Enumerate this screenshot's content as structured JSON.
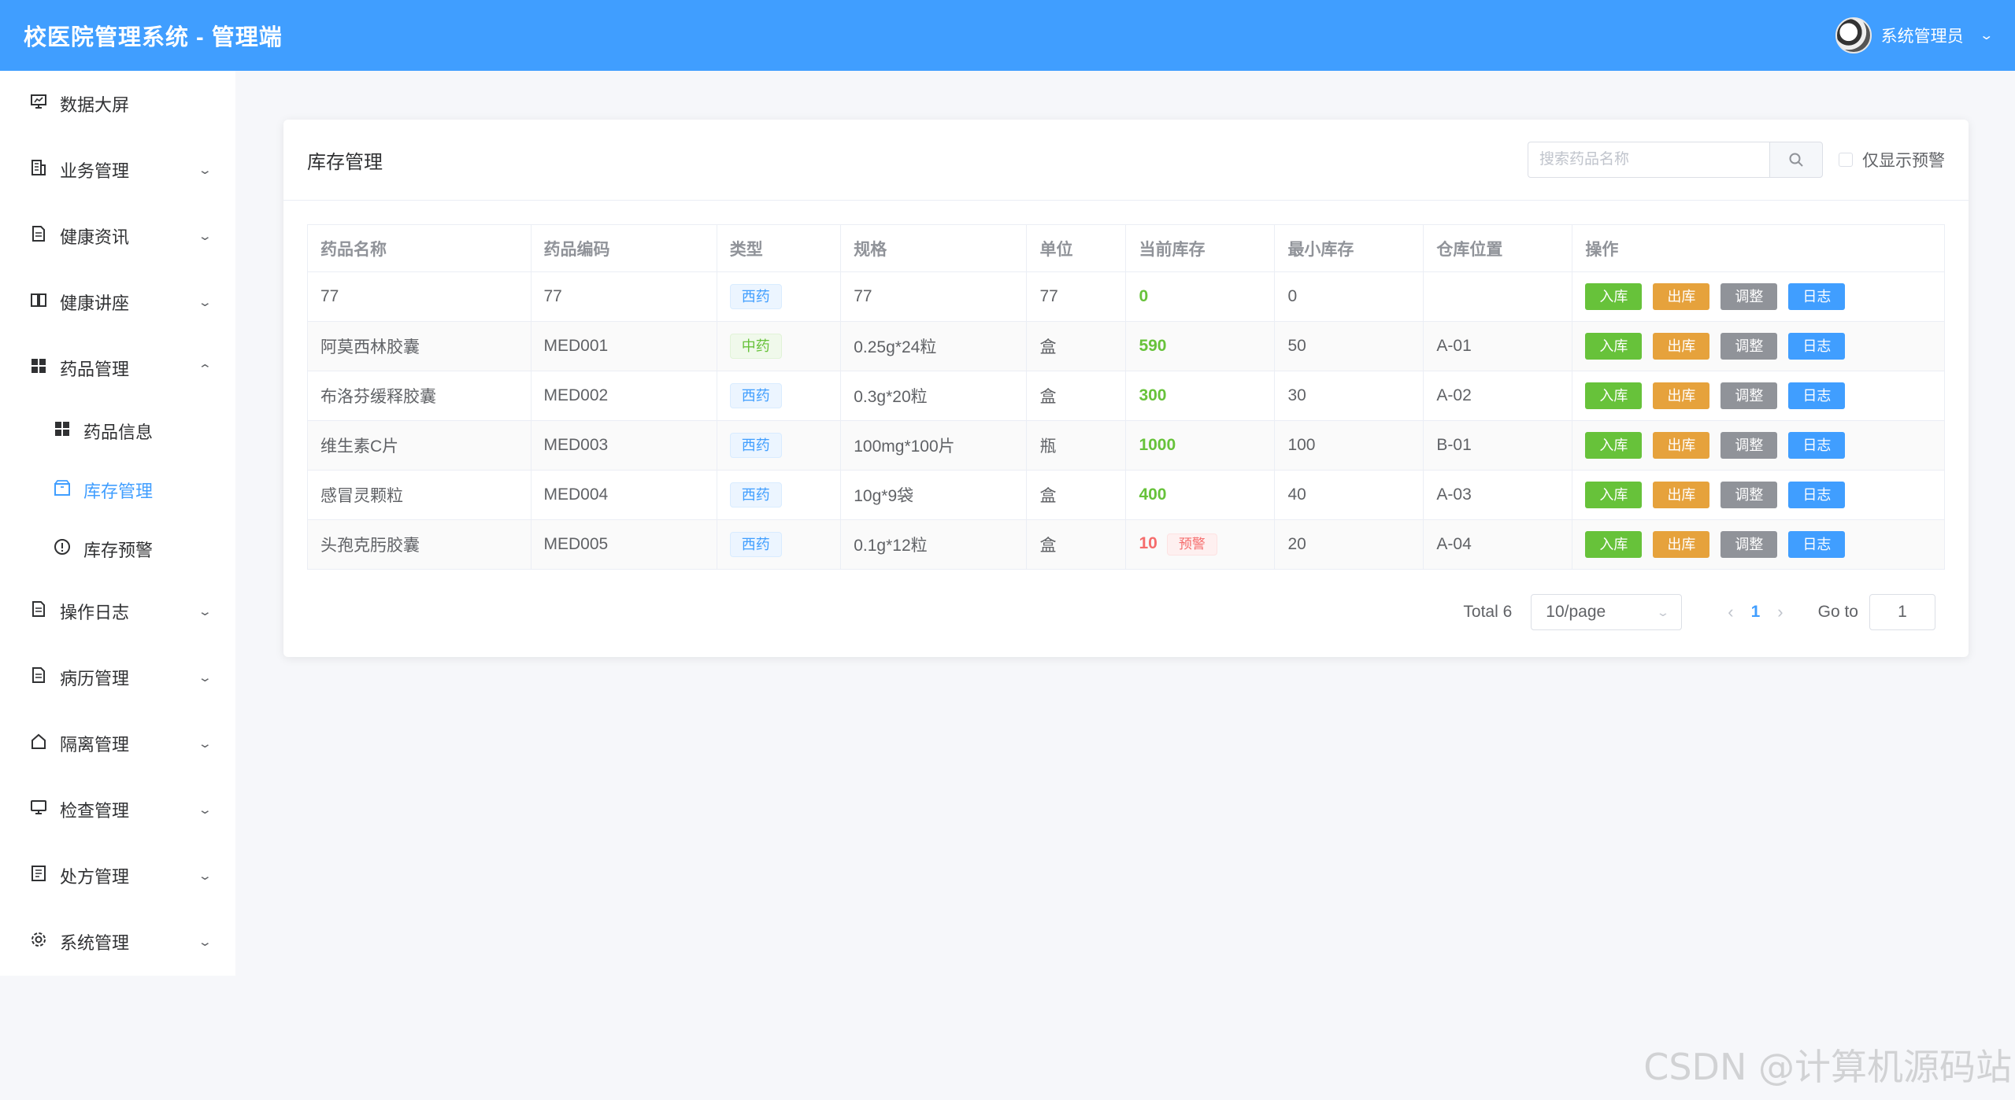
{
  "header": {
    "title": "校医院管理系统 - 管理端",
    "username": "系统管理员"
  },
  "sidebar": {
    "items": [
      {
        "label": "数据大屏",
        "icon": "monitor-chart-icon",
        "expandable": false
      },
      {
        "label": "业务管理",
        "icon": "building-icon",
        "expandable": true
      },
      {
        "label": "健康资讯",
        "icon": "document-icon",
        "expandable": true
      },
      {
        "label": "健康讲座",
        "icon": "book-icon",
        "expandable": true
      },
      {
        "label": "药品管理",
        "icon": "grid-icon",
        "expandable": true,
        "expanded": true
      }
    ],
    "sub_items": [
      {
        "label": "药品信息",
        "icon": "grid-icon"
      },
      {
        "label": "库存管理",
        "icon": "box-icon",
        "active": true
      },
      {
        "label": "库存预警",
        "icon": "warning-circle-icon"
      }
    ],
    "items_after": [
      {
        "label": "操作日志",
        "icon": "document-icon"
      },
      {
        "label": "病历管理",
        "icon": "document-icon"
      },
      {
        "label": "隔离管理",
        "icon": "house-icon"
      },
      {
        "label": "检查管理",
        "icon": "monitor-icon"
      },
      {
        "label": "处方管理",
        "icon": "list-icon"
      },
      {
        "label": "系统管理",
        "icon": "gear-icon"
      }
    ]
  },
  "card": {
    "title": "库存管理",
    "search_placeholder": "搜索药品名称",
    "warn_only_label": "仅显示预警"
  },
  "table": {
    "columns": [
      "药品名称",
      "药品编码",
      "类型",
      "规格",
      "单位",
      "当前库存",
      "最小库存",
      "仓库位置",
      "操作"
    ],
    "rows": [
      {
        "name": "77",
        "code": "77",
        "type": "西药",
        "spec": "77",
        "unit": "77",
        "stock": "0",
        "min": "0",
        "location": "",
        "warning": false
      },
      {
        "name": "阿莫西林胶囊",
        "code": "MED001",
        "type": "中药",
        "spec": "0.25g*24粒",
        "unit": "盒",
        "stock": "590",
        "min": "50",
        "location": "A-01",
        "warning": false
      },
      {
        "name": "布洛芬缓释胶囊",
        "code": "MED002",
        "type": "西药",
        "spec": "0.3g*20粒",
        "unit": "盒",
        "stock": "300",
        "min": "30",
        "location": "A-02",
        "warning": false
      },
      {
        "name": "维生素C片",
        "code": "MED003",
        "type": "西药",
        "spec": "100mg*100片",
        "unit": "瓶",
        "stock": "1000",
        "min": "100",
        "location": "B-01",
        "warning": false
      },
      {
        "name": "感冒灵颗粒",
        "code": "MED004",
        "type": "西药",
        "spec": "10g*9袋",
        "unit": "盒",
        "stock": "400",
        "min": "40",
        "location": "A-03",
        "warning": false
      },
      {
        "name": "头孢克肟胶囊",
        "code": "MED005",
        "type": "西药",
        "spec": "0.1g*12粒",
        "unit": "盒",
        "stock": "10",
        "min": "20",
        "location": "A-04",
        "warning": true
      }
    ],
    "warning_tag": "预警",
    "actions": {
      "in": "入库",
      "out": "出库",
      "adjust": "调整",
      "log": "日志"
    }
  },
  "pagination": {
    "total": "Total 6",
    "page_size": "10/page",
    "current_page": "1",
    "goto_label": "Go to",
    "goto_value": "1"
  },
  "watermark": "CSDN @计算机源码站",
  "colors": {
    "primary": "#409eff",
    "success": "#67c23a",
    "warning": "#e6a23c",
    "info": "#909399",
    "danger": "#f56c6c"
  }
}
